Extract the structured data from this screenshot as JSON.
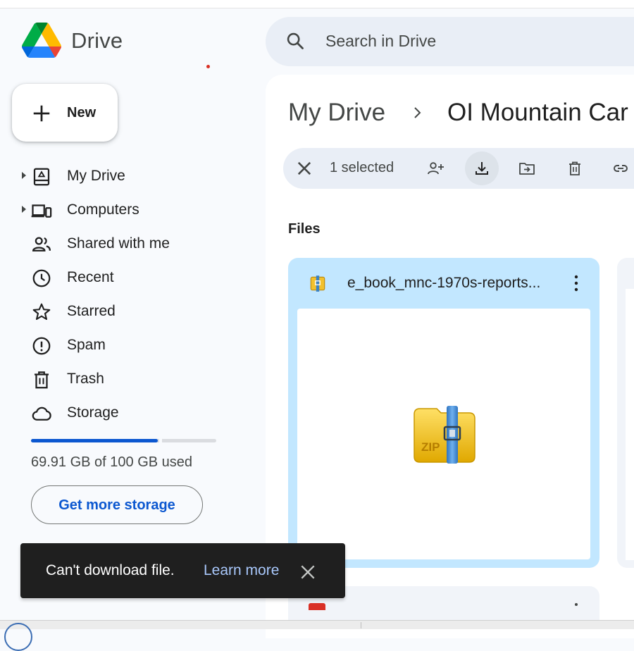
{
  "app": {
    "brand": "Drive"
  },
  "search": {
    "placeholder": "Search in Drive"
  },
  "new_button": {
    "label": "New"
  },
  "sidebar": {
    "items": [
      {
        "label": "My Drive",
        "icon": "my-drive-icon",
        "expandable": true
      },
      {
        "label": "Computers",
        "icon": "computers-icon",
        "expandable": true
      },
      {
        "label": "Shared with me",
        "icon": "shared-icon",
        "expandable": false
      },
      {
        "label": "Recent",
        "icon": "clock-icon",
        "expandable": false
      },
      {
        "label": "Starred",
        "icon": "star-icon",
        "expandable": false
      },
      {
        "label": "Spam",
        "icon": "spam-icon",
        "expandable": false
      },
      {
        "label": "Trash",
        "icon": "trash-icon",
        "expandable": false
      },
      {
        "label": "Storage",
        "icon": "cloud-icon",
        "expandable": false
      }
    ]
  },
  "storage": {
    "used_fraction": 0.6991,
    "text": "69.91 GB of 100 GB used",
    "button_label": "Get more storage"
  },
  "breadcrumb": {
    "root": "My Drive",
    "current": "OI Mountain Car"
  },
  "selection_bar": {
    "text": "1 selected",
    "tools": [
      "share-icon",
      "download-icon",
      "move-icon",
      "trash-icon",
      "link-icon"
    ]
  },
  "files": {
    "section_label": "Files",
    "cards": [
      {
        "title": "e_book_mnc-1970s-reports...",
        "type": "zip",
        "preview_label": "ZIP"
      }
    ]
  },
  "snackbar": {
    "message": "Can't download file.",
    "action": "Learn more"
  },
  "colors": {
    "accent": "#0b57d0",
    "selected_card": "#c2e7ff",
    "snackbar_bg": "#1f1f1f",
    "snackbar_link": "#a8c7fa"
  }
}
